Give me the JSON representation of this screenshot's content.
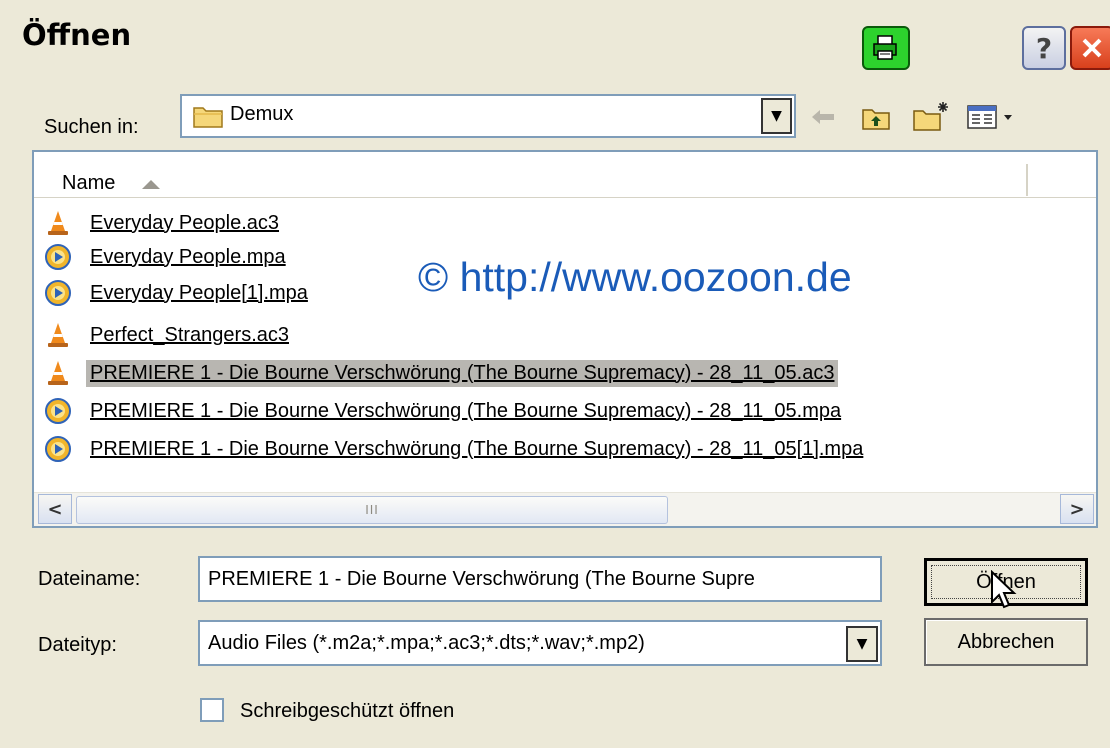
{
  "window": {
    "title": "Öffnen",
    "help_label": "?"
  },
  "look_in": {
    "label": "Suchen in:",
    "value": "Demux",
    "icon": "folder-icon"
  },
  "toolbar": {
    "icons": [
      "back-icon",
      "up-folder-icon",
      "new-folder-icon",
      "view-menu-icon"
    ]
  },
  "file_list": {
    "column_name": "Name",
    "files": [
      {
        "name": "Everyday People.ac3",
        "icon": "vlc-cone-icon"
      },
      {
        "name": "Everyday People.mpa",
        "icon": "audio-file-icon"
      },
      {
        "name": "Everyday People[1].mpa",
        "icon": "audio-file-icon"
      },
      {
        "name": "Perfect_Strangers.ac3",
        "icon": "vlc-cone-icon"
      },
      {
        "name": "PREMIERE 1 - Die Bourne Verschwörung (The Bourne Supremacy) - 28_11_05.ac3",
        "icon": "vlc-cone-icon",
        "selected": true
      },
      {
        "name": "PREMIERE 1 - Die Bourne Verschwörung (The Bourne Supremacy) - 28_11_05.mpa",
        "icon": "audio-file-icon"
      },
      {
        "name": "PREMIERE 1 - Die Bourne Verschwörung (The Bourne Supremacy) - 28_11_05[1].mpa",
        "icon": "audio-file-icon"
      }
    ],
    "watermark": "© http://www.oozoon.de"
  },
  "scrollbar": {
    "thumb_grip": "III"
  },
  "filename": {
    "label": "Dateiname:",
    "value": "PREMIERE 1 - Die Bourne Verschwörung (The Bourne Supre"
  },
  "filetype": {
    "label": "Dateityp:",
    "value": "Audio Files (*.m2a;*.mpa;*.ac3;*.dts;*.wav;*.mp2)"
  },
  "buttons": {
    "open": "Öffnen",
    "cancel": "Abbrechen"
  },
  "readonly": {
    "label": "Schreibgeschützt öffnen",
    "checked": false
  },
  "colors": {
    "selection": "#b8b6b1",
    "watermark": "#1a5bb8",
    "dialog_bg": "#ece9d8"
  }
}
